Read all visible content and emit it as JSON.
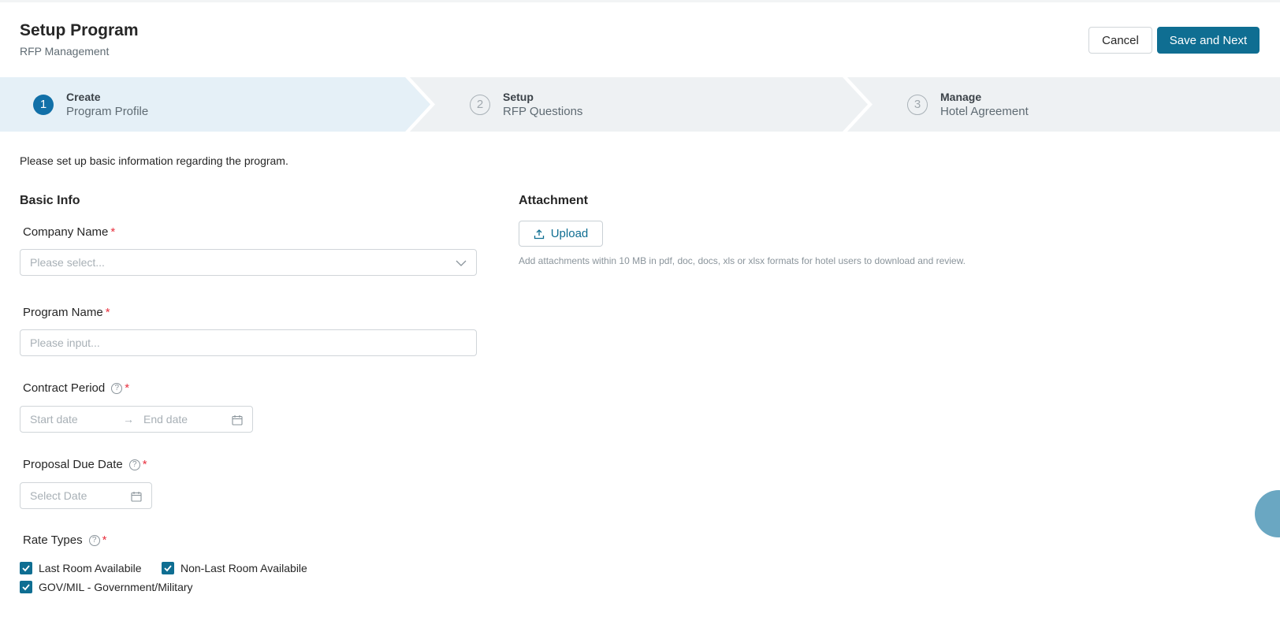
{
  "header": {
    "title": "Setup Program",
    "subtitle": "RFP Management",
    "cancel_label": "Cancel",
    "save_label": "Save and Next"
  },
  "steps": [
    {
      "number": "1",
      "title": "Create",
      "subtitle": "Program Profile",
      "active": true
    },
    {
      "number": "2",
      "title": "Setup",
      "subtitle": "RFP Questions",
      "active": false
    },
    {
      "number": "3",
      "title": "Manage",
      "subtitle": "Hotel Agreement",
      "active": false
    }
  ],
  "intro": "Please set up basic information regarding the program.",
  "basic_info": {
    "title": "Basic Info",
    "company_name": {
      "label": "Company Name",
      "placeholder": "Please select..."
    },
    "program_name": {
      "label": "Program Name",
      "placeholder": "Please input..."
    },
    "contract_period": {
      "label": "Contract Period",
      "start_placeholder": "Start date",
      "end_placeholder": "End date"
    },
    "proposal_due_date": {
      "label": "Proposal Due Date",
      "placeholder": "Select Date"
    },
    "rate_types": {
      "label": "Rate Types",
      "options": [
        {
          "label": "Last Room Availabile",
          "checked": true
        },
        {
          "label": "Non-Last Room Availabile",
          "checked": true
        },
        {
          "label": "GOV/MIL - Government/Military",
          "checked": true
        }
      ]
    }
  },
  "attachment": {
    "title": "Attachment",
    "upload_label": "Upload",
    "hint": "Add attachments within 10 MB in pdf, doc, docs, xls or xlsx formats for hotel users to download and review."
  },
  "required_mark": "*",
  "help_mark": "?",
  "colors": {
    "primary": "#0f6e92",
    "active_step": "#1170a8",
    "required": "#e8303e"
  }
}
